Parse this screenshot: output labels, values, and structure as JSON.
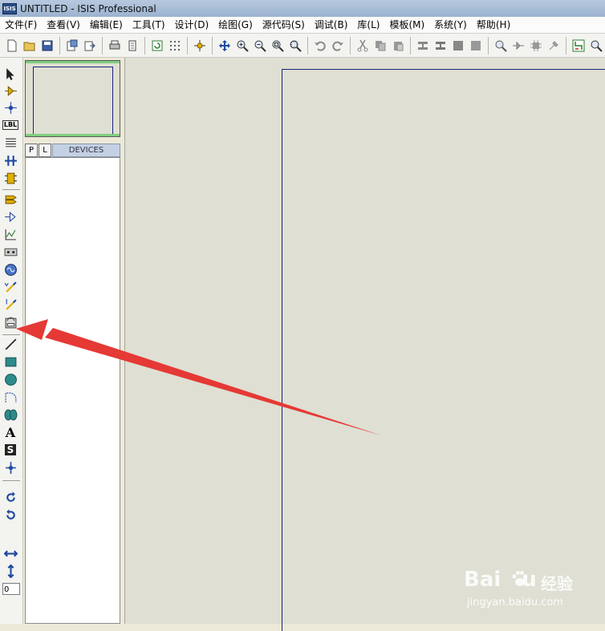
{
  "window": {
    "title": "UNTITLED - ISIS Professional",
    "app_icon_text": "ISIS"
  },
  "menu": {
    "items": [
      "文件(F)",
      "查看(V)",
      "编辑(E)",
      "工具(T)",
      "设计(D)",
      "绘图(G)",
      "源代码(S)",
      "调试(B)",
      "库(L)",
      "模板(M)",
      "系统(Y)",
      "帮助(H)"
    ]
  },
  "toolbar": {
    "icons": [
      "new-icon",
      "open-icon",
      "save-icon",
      "import-icon",
      "export-icon",
      "print-icon",
      "print-area-icon",
      "refresh-icon",
      "grid-icon",
      "origin-icon",
      "pan-icon",
      "zoom-in-icon",
      "zoom-out-icon",
      "zoom-all-icon",
      "zoom-area-icon",
      "undo-icon",
      "redo-icon",
      "cut-icon",
      "copy-icon",
      "paste-icon",
      "block-copy-icon",
      "block-move-icon",
      "block-rotate-icon",
      "block-delete-icon",
      "pick-device-icon",
      "make-device-icon",
      "packaging-icon",
      "decompose-icon",
      "wire-autorouter-icon",
      "search-icon"
    ]
  },
  "left_toolbar": {
    "icons": [
      "selection-mode-icon",
      "component-mode-icon",
      "junction-dot-icon",
      "wire-label-icon",
      "text-script-icon",
      "buses-icon",
      "subcircuit-icon",
      "terminals-icon",
      "device-pins-icon",
      "graph-icon",
      "tape-recorder-icon",
      "generator-icon",
      "voltage-probe-icon",
      "current-probe-icon",
      "virtual-instruments-icon",
      "line-2d-icon",
      "box-2d-icon",
      "circle-2d-icon",
      "arc-2d-icon",
      "path-2d-icon",
      "text-2d-icon",
      "symbol-2d-icon",
      "markers-2d-icon",
      "rotate-cw-icon",
      "rotate-ccw-icon",
      "mirror-x-icon",
      "mirror-y-icon"
    ],
    "label_text": "LBL",
    "text2d_glyph": "A",
    "symbol_glyph": "S",
    "rotation_value": "0"
  },
  "device_panel": {
    "pick_button": "P",
    "library_button": "L",
    "header": "DEVICES"
  },
  "watermark": {
    "brand": "Bai",
    "brand_suffix": "u",
    "cn": "经验",
    "url": "jingyan.baidu.com"
  },
  "colors": {
    "canvas": "#dfdfd3",
    "sheet_border": "#1a237e",
    "annotation_arrow": "#e53935",
    "overview_edge": "#7fcf7f"
  }
}
